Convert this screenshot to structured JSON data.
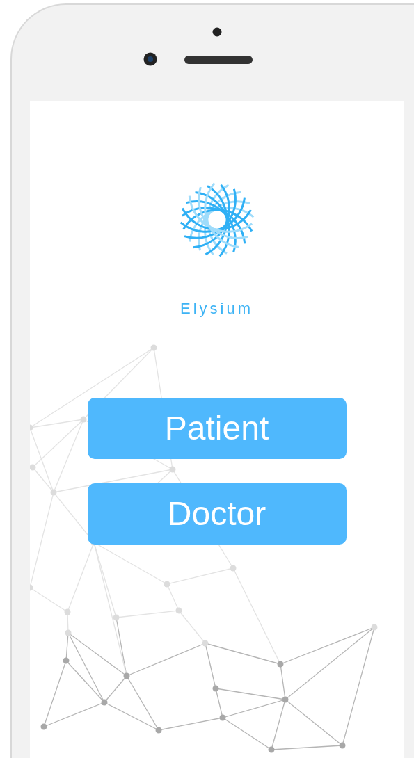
{
  "app": {
    "brand": "Elysium"
  },
  "buttons": [
    {
      "label": "Patient"
    },
    {
      "label": "Doctor"
    }
  ]
}
